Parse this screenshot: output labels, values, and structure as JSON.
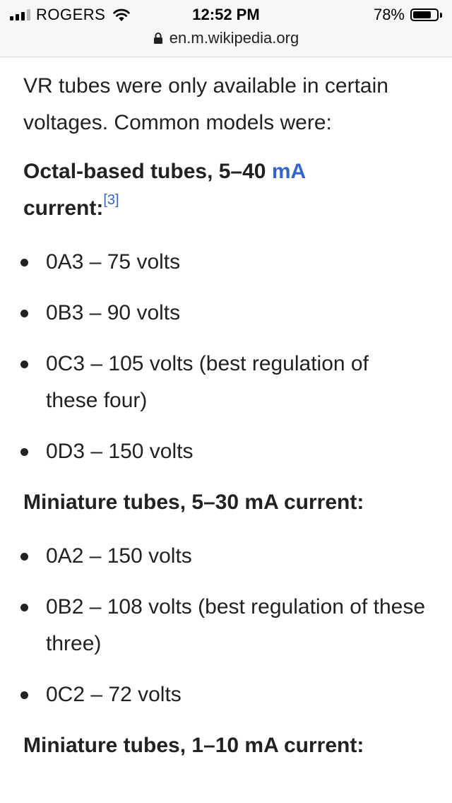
{
  "status_bar": {
    "carrier": "ROGERS",
    "time": "12:52 PM",
    "battery_percent": "78%",
    "battery_level": 0.78,
    "signal_bars_active": 3,
    "signal_bars_total": 4,
    "url": "en.m.wikipedia.org"
  },
  "article": {
    "intro": "VR tubes were only available in certain voltages. Common models were:",
    "sections": [
      {
        "heading_prefix": "Octal-based tubes, 5–40 ",
        "heading_link": "mA",
        "heading_suffix": " current:",
        "reference": "[3]",
        "items": [
          "0A3 – 75 volts",
          "0B3 – 90 volts",
          "0C3 – 105 volts (best regulation of these four)",
          "0D3 – 150 volts"
        ]
      },
      {
        "heading": "Miniature tubes, 5–30 mA current:",
        "items": [
          "0A2 – 150 volts",
          "0B2 – 108 volts (best regulation of these three)",
          "0C2 – 72 volts"
        ]
      },
      {
        "heading": "Miniature tubes, 1–10 mA current:"
      }
    ]
  },
  "colors": {
    "link": "#3366cc",
    "text": "#222222",
    "status_bar_bg": "#f7f7f7"
  },
  "icons": {
    "signal": "cellular-signal-icon",
    "wifi": "wifi-icon",
    "battery": "battery-icon",
    "lock": "lock-icon"
  }
}
